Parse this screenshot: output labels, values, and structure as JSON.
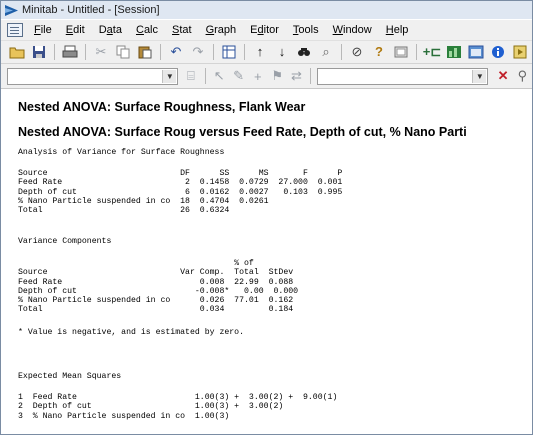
{
  "window": {
    "title": "Minitab - Untitled - [Session]"
  },
  "menubar": {
    "items": [
      {
        "key": "F",
        "rest": "ile"
      },
      {
        "key": "E",
        "rest": "dit"
      },
      {
        "pre": "D",
        "key": "a",
        "rest": "ta"
      },
      {
        "key": "C",
        "rest": "alc"
      },
      {
        "key": "S",
        "rest": "tat"
      },
      {
        "key": "G",
        "rest": "raph"
      },
      {
        "pre": "E",
        "key": "d",
        "rest": "itor"
      },
      {
        "key": "T",
        "rest": "ools"
      },
      {
        "key": "W",
        "rest": "indow"
      },
      {
        "key": "H",
        "rest": "elp"
      }
    ]
  },
  "toolbar": {
    "icons": [
      "open-icon",
      "save-icon",
      "print-icon",
      "cut-icon",
      "copy-icon",
      "paste-icon",
      "undo-icon",
      "redo-icon",
      "worksheet-icon",
      "arrow-up-icon",
      "arrow-down-icon",
      "find-icon",
      "find-replace-icon",
      "cancel-icon",
      "help-icon",
      "project-manager-icon",
      "graph-brush-icon",
      "graph-icon",
      "session-icon",
      "info-icon",
      "history-icon"
    ]
  },
  "session": {
    "heading1": "Nested ANOVA: Surface Roughness, Flank Wear",
    "heading2": "Nested ANOVA: Surface Roug versus Feed Rate, Depth of cut, % Nano Parti",
    "anova_title": "Analysis of Variance for Surface Roughness",
    "anova_table": "Source                           DF      SS      MS       F      P\nFeed Rate                         2  0.1458  0.0729  27.000  0.001\nDepth of cut                      6  0.0162  0.0027   0.103  0.995\n% Nano Particle suspended in co  18  0.4704  0.0261\nTotal                            26  0.6324",
    "variance_title": "Variance Components",
    "variance_table": "                                            % of\nSource                           Var Comp.  Total  StDev\nFeed Rate                            0.008  22.99  0.088\nDepth of cut                        -0.008*   0.00  0.000\n% Nano Particle suspended in co      0.026  77.01  0.162\nTotal                                0.034         0.184",
    "note": "* Value is negative, and is estimated by zero.",
    "ems_title": "Expected Mean Squares",
    "ems_table": "1  Feed Rate                        1.00(3) +  3.00(2) +  9.00(1)\n2  Depth of cut                     1.00(3) +  3.00(2)\n3  % Nano Particle suspended in co  1.00(3)"
  },
  "colors": {
    "titlebar": "#dfe7f2",
    "chrome": "#f0f0f0",
    "content": "#ffffff"
  }
}
